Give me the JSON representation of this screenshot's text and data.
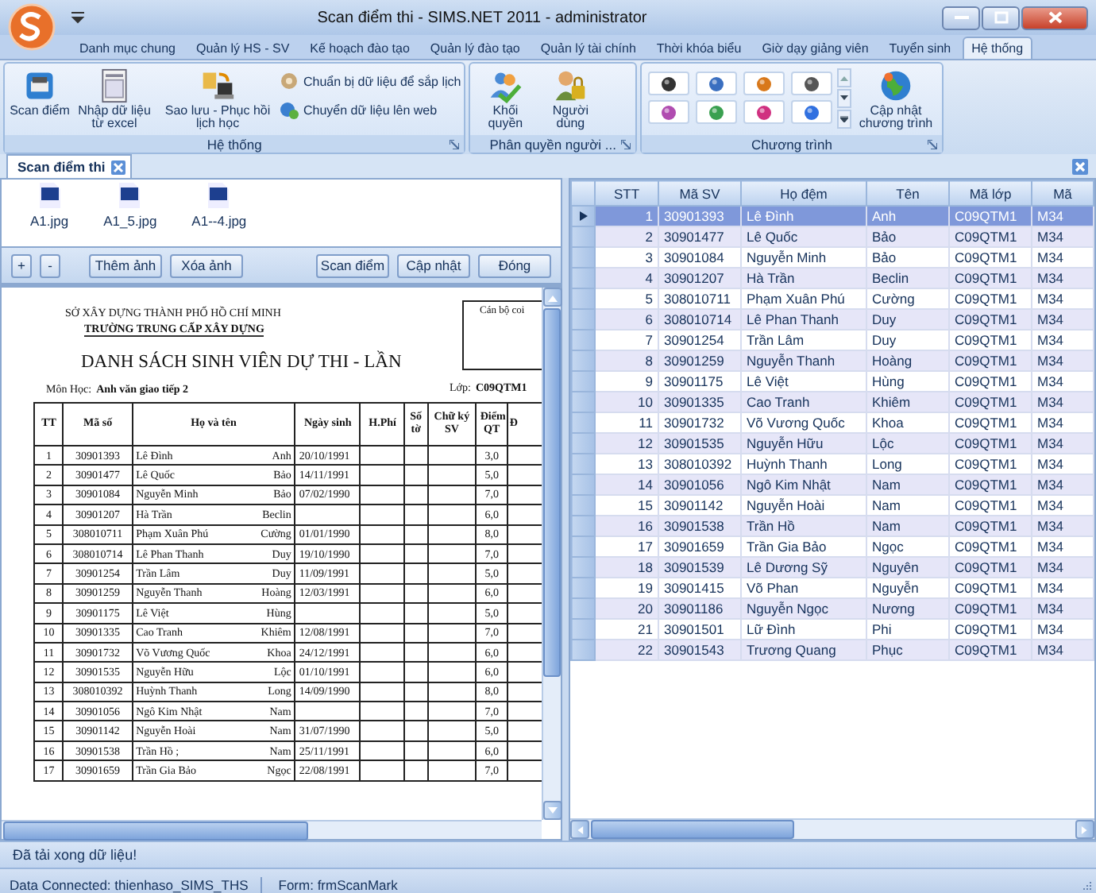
{
  "window": {
    "title": "Scan điểm thi - SIMS.NET 2011 - administrator"
  },
  "menu_tabs": [
    {
      "label": "Danh mục chung",
      "selected": false
    },
    {
      "label": "Quản lý HS - SV",
      "selected": false
    },
    {
      "label": "Kế hoạch đào tạo",
      "selected": false
    },
    {
      "label": "Quản lý đào tạo",
      "selected": false
    },
    {
      "label": "Quản lý tài chính",
      "selected": false
    },
    {
      "label": "Thời khóa biểu",
      "selected": false
    },
    {
      "label": "Giờ dạy giảng viên",
      "selected": false
    },
    {
      "label": "Tuyển sinh",
      "selected": false
    },
    {
      "label": "Hệ thống",
      "selected": true
    }
  ],
  "ribbon": {
    "system": {
      "label": "Hệ thống",
      "large_buttons": [
        "Scan điểm",
        "Nhập dữ liệu từ excel",
        "Sao lưu - Phục hồi lịch học"
      ],
      "small_buttons": [
        "Chuẩn bị dữ liệu để sắp lịch",
        "Chuyển dữ liệu lên web"
      ]
    },
    "permissions": {
      "label": "Phân quyền người ...",
      "large_buttons": [
        "Khối quyền",
        "Người dùng"
      ]
    },
    "programs": {
      "label": "Chương trình",
      "large_buttons": [
        "Cập nhật chương trình"
      ]
    }
  },
  "doc_tabs": [
    {
      "label": "Scan điểm thi",
      "selected": true
    }
  ],
  "images": [
    "A1.jpg",
    "A1_5.jpg",
    "A1--4.jpg"
  ],
  "zoom_buttons": [
    "+",
    "-"
  ],
  "image_buttons": [
    "Thêm ảnh",
    "Xóa ảnh"
  ],
  "action_buttons": [
    "Scan điểm",
    "Cập nhật",
    "Đóng"
  ],
  "document": {
    "department": "SỞ XÂY DỰNG THÀNH PHỐ HỒ CHÍ MINH",
    "school": "TRƯỜNG TRUNG CẤP XÂY DỰNG",
    "box_label": "Cán bộ coi",
    "title": "DANH SÁCH SINH VIÊN DỰ THI - LẦN",
    "subject_label": "Môn Học:",
    "subject": "Anh văn giao tiếp 2",
    "class_label": "Lớp:",
    "class": "C09QTM1",
    "columns": [
      "TT",
      "Mã số",
      "Họ và tên",
      "Ngày sinh",
      "H.Phí",
      "Số tờ",
      "Chữ ký SV",
      "Điểm QT",
      "Đ"
    ],
    "rows": [
      {
        "tt": "1",
        "id": "30901393",
        "last": "Lê Đình",
        "first": "Anh",
        "dob": "20/10/1991",
        "score": "3,0"
      },
      {
        "tt": "2",
        "id": "30901477",
        "last": "Lê Quốc",
        "first": "Bảo",
        "dob": "14/11/1991",
        "score": "5,0"
      },
      {
        "tt": "3",
        "id": "30901084",
        "last": "Nguyễn Minh",
        "first": "Bảo",
        "dob": "07/02/1990",
        "score": "7,0"
      },
      {
        "tt": "4",
        "id": "30901207",
        "last": "Hà Trần",
        "first": "Beclin",
        "score": "6,0"
      },
      {
        "tt": "5",
        "id": "308010711",
        "last": "Phạm Xuân Phú",
        "first": "Cường",
        "dob": "01/01/1990",
        "score": "8,0"
      },
      {
        "tt": "6",
        "id": "308010714",
        "last": "Lê Phan Thanh",
        "first": "Duy",
        "dob": "19/10/1990",
        "score": "7,0"
      },
      {
        "tt": "7",
        "id": "30901254",
        "last": "Trần Lâm",
        "first": "Duy",
        "dob": "11/09/1991",
        "score": "5,0"
      },
      {
        "tt": "8",
        "id": "30901259",
        "last": "Nguyễn Thanh",
        "first": "Hoàng",
        "dob": "12/03/1991",
        "score": "6,0"
      },
      {
        "tt": "9",
        "id": "30901175",
        "last": "Lê Việt",
        "first": "Hùng",
        "score": "5,0"
      },
      {
        "tt": "10",
        "id": "30901335",
        "last": "Cao Tranh",
        "first": "Khiêm",
        "dob": "12/08/1991",
        "score": "7,0"
      },
      {
        "tt": "11",
        "id": "30901732",
        "last": "Võ Vương Quốc",
        "first": "Khoa",
        "dob": "24/12/1991",
        "score": "6,0"
      },
      {
        "tt": "12",
        "id": "30901535",
        "last": "Nguyễn Hữu",
        "first": "Lộc",
        "dob": "01/10/1991",
        "score": "6,0"
      },
      {
        "tt": "13",
        "id": "308010392",
        "last": "Huỳnh Thanh",
        "first": "Long",
        "dob": "14/09/1990",
        "score": "8,0"
      },
      {
        "tt": "14",
        "id": "30901056",
        "last": "Ngô Kim Nhật",
        "first": "Nam",
        "score": "7,0"
      },
      {
        "tt": "15",
        "id": "30901142",
        "last": "Nguyễn Hoài",
        "first": "Nam",
        "dob": "31/07/1990",
        "score": "5,0"
      },
      {
        "tt": "16",
        "id": "30901538",
        "last": "Trần Hồ ;",
        "first": "Nam",
        "dob": "25/11/1991",
        "score": "6,0"
      },
      {
        "tt": "17",
        "id": "30901659",
        "last": "Trần Gia Bảo",
        "first": "Ngọc",
        "dob": "22/08/1991",
        "score": "7,0"
      }
    ]
  },
  "grid": {
    "columns": [
      "STT",
      "Mã SV",
      "Họ đệm",
      "Tên",
      "Mã lớp",
      "Mã"
    ],
    "rows": [
      {
        "cells": [
          "1",
          "30901393",
          "Lê Đình",
          "Anh",
          "C09QTM1",
          "M34"
        ],
        "selected": true
      },
      {
        "cells": [
          "2",
          "30901477",
          "Lê Quốc",
          "Bảo",
          "C09QTM1",
          "M34"
        ],
        "selected": false
      },
      {
        "cells": [
          "3",
          "30901084",
          "Nguyễn Minh",
          "Bảo",
          "C09QTM1",
          "M34"
        ],
        "selected": false
      },
      {
        "cells": [
          "4",
          "30901207",
          "Hà Trần",
          "Beclin",
          "C09QTM1",
          "M34"
        ],
        "selected": false
      },
      {
        "cells": [
          "5",
          "308010711",
          "Phạm Xuân Phú",
          "Cường",
          "C09QTM1",
          "M34"
        ],
        "selected": false
      },
      {
        "cells": [
          "6",
          "308010714",
          "Lê Phan Thanh",
          "Duy",
          "C09QTM1",
          "M34"
        ],
        "selected": false
      },
      {
        "cells": [
          "7",
          "30901254",
          "Trần Lâm",
          "Duy",
          "C09QTM1",
          "M34"
        ],
        "selected": false
      },
      {
        "cells": [
          "8",
          "30901259",
          "Nguyễn Thanh",
          "Hoàng",
          "C09QTM1",
          "M34"
        ],
        "selected": false
      },
      {
        "cells": [
          "9",
          "30901175",
          "Lê Việt",
          "Hùng",
          "C09QTM1",
          "M34"
        ],
        "selected": false
      },
      {
        "cells": [
          "10",
          "30901335",
          "Cao Tranh",
          "Khiêm",
          "C09QTM1",
          "M34"
        ],
        "selected": false
      },
      {
        "cells": [
          "11",
          "30901732",
          "Võ Vương Quốc",
          "Khoa",
          "C09QTM1",
          "M34"
        ],
        "selected": false
      },
      {
        "cells": [
          "12",
          "30901535",
          "Nguyễn Hữu",
          "Lộc",
          "C09QTM1",
          "M34"
        ],
        "selected": false
      },
      {
        "cells": [
          "13",
          "308010392",
          "Huỳnh Thanh",
          "Long",
          "C09QTM1",
          "M34"
        ],
        "selected": false
      },
      {
        "cells": [
          "14",
          "30901056",
          "Ngô Kim Nhật",
          "Nam",
          "C09QTM1",
          "M34"
        ],
        "selected": false
      },
      {
        "cells": [
          "15",
          "30901142",
          "Nguyễn Hoài",
          "Nam",
          "C09QTM1",
          "M34"
        ],
        "selected": false
      },
      {
        "cells": [
          "16",
          "30901538",
          "Trần Hồ",
          "Nam",
          "C09QTM1",
          "M34"
        ],
        "selected": false
      },
      {
        "cells": [
          "17",
          "30901659",
          "Trần Gia Bảo",
          "Ngọc",
          "C09QTM1",
          "M34"
        ],
        "selected": false
      },
      {
        "cells": [
          "18",
          "30901539",
          "Lê Dương Sỹ",
          "Nguyên",
          "C09QTM1",
          "M34"
        ],
        "selected": false
      },
      {
        "cells": [
          "19",
          "30901415",
          "Võ Phan",
          "Nguyễn",
          "C09QTM1",
          "M34"
        ],
        "selected": false
      },
      {
        "cells": [
          "20",
          "30901186",
          "Nguyễn Ngọc",
          "Nương",
          "C09QTM1",
          "M34"
        ],
        "selected": false
      },
      {
        "cells": [
          "21",
          "30901501",
          "Lữ Đình",
          "Phi",
          "C09QTM1",
          "M34"
        ],
        "selected": false
      },
      {
        "cells": [
          "22",
          "30901543",
          "Trương Quang",
          "Phục",
          "C09QTM1",
          "M34"
        ],
        "selected": false
      }
    ]
  },
  "message": "Đã tải xong dữ liệu!",
  "status_bar": [
    "Data Connected: thienhaso_SIMS_THS",
    "Form: frmScanMark"
  ]
}
